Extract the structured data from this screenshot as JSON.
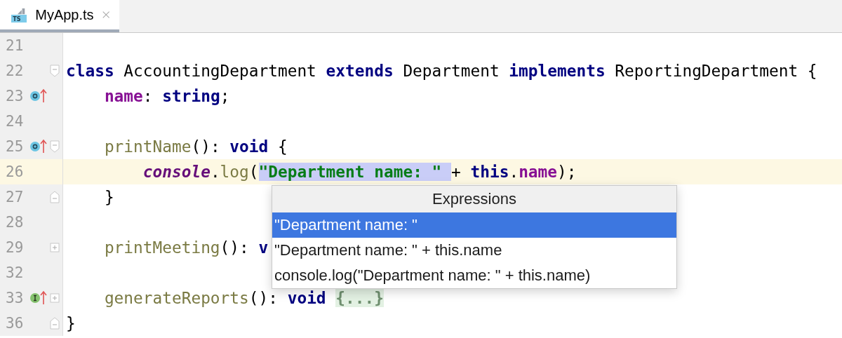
{
  "tabs": [
    {
      "label": "MyApp.ts",
      "icon_label": "TS",
      "selected": true
    }
  ],
  "lines": [
    {
      "number": "21",
      "current": false
    },
    {
      "number": "22",
      "current": false,
      "icons": [
        {
          "kind": "fold-start"
        }
      ],
      "tokens": [
        {
          "text": "class",
          "kind": "keyword"
        },
        {
          "text": " AccountingDepartment ",
          "kind": "plain"
        },
        {
          "text": "extends",
          "kind": "keyword"
        },
        {
          "text": " Department ",
          "kind": "plain"
        },
        {
          "text": "implements",
          "kind": "keyword"
        },
        {
          "text": " ReportingDepartment {",
          "kind": "plain"
        }
      ]
    },
    {
      "number": "23",
      "current": false,
      "icons": [
        {
          "kind": "overriding"
        }
      ],
      "tokens": [
        {
          "text": "    name",
          "kind": "field"
        },
        {
          "text": ": ",
          "kind": "plain"
        },
        {
          "text": "string",
          "kind": "keyword"
        },
        {
          "text": ";",
          "kind": "plain"
        }
      ]
    },
    {
      "number": "24",
      "current": false
    },
    {
      "number": "25",
      "current": false,
      "icons": [
        {
          "kind": "overriding"
        },
        {
          "kind": "fold-start"
        }
      ],
      "tokens": [
        {
          "text": "    printName",
          "kind": "method"
        },
        {
          "text": "(): ",
          "kind": "plain"
        },
        {
          "text": "void",
          "kind": "keyword"
        },
        {
          "text": " {",
          "kind": "plain"
        }
      ]
    },
    {
      "number": "26",
      "current": true,
      "tokens": [
        {
          "text": "        console",
          "kind": "global",
          "highlighted": false
        },
        {
          "text": ".",
          "kind": "plain",
          "highlighted": false
        },
        {
          "text": "log",
          "kind": "method",
          "highlighted": false
        },
        {
          "text": "(",
          "kind": "plain",
          "highlighted": false
        },
        {
          "text": "\"Department name: \" ",
          "kind": "string",
          "highlighted": true
        },
        {
          "text": "+ ",
          "kind": "plain",
          "highlighted": false
        },
        {
          "text": "this",
          "kind": "keyword",
          "highlighted": false
        },
        {
          "text": ".",
          "kind": "plain",
          "highlighted": false
        },
        {
          "text": "name",
          "kind": "field",
          "highlighted": false
        },
        {
          "text": ");",
          "kind": "plain",
          "highlighted": false
        }
      ]
    },
    {
      "number": "27",
      "current": false,
      "icons": [
        {
          "kind": "fold-end"
        }
      ],
      "tokens": [
        {
          "text": "    }",
          "kind": "plain"
        }
      ]
    },
    {
      "number": "28",
      "current": false
    },
    {
      "number": "29",
      "current": false,
      "icons": [
        {
          "kind": "folded"
        }
      ],
      "tokens": [
        {
          "text": "    printMeeting",
          "kind": "method"
        },
        {
          "text": "(): ",
          "kind": "plain"
        },
        {
          "text": "v",
          "kind": "keyword"
        }
      ]
    },
    {
      "number": "32",
      "current": false
    },
    {
      "number": "33",
      "current": false,
      "icons": [
        {
          "kind": "implementing"
        },
        {
          "kind": "folded"
        }
      ],
      "tokens": [
        {
          "text": "    generateReports",
          "kind": "method"
        },
        {
          "text": "(): ",
          "kind": "plain"
        },
        {
          "text": "void ",
          "kind": "keyword"
        },
        {
          "text": "{...}",
          "kind": "folded"
        }
      ]
    },
    {
      "number": "36",
      "current": false,
      "icons": [
        {
          "kind": "fold-end"
        }
      ],
      "tokens": [
        {
          "text": "}",
          "kind": "plain"
        }
      ]
    }
  ],
  "popup": {
    "title": "Expressions",
    "items": [
      {
        "label": "\"Department name: \"",
        "selected": true
      },
      {
        "label": "\"Department name: \" + this.name",
        "selected": false
      },
      {
        "label": "console.log(\"Department name: \" + this.name)",
        "selected": false
      }
    ]
  }
}
